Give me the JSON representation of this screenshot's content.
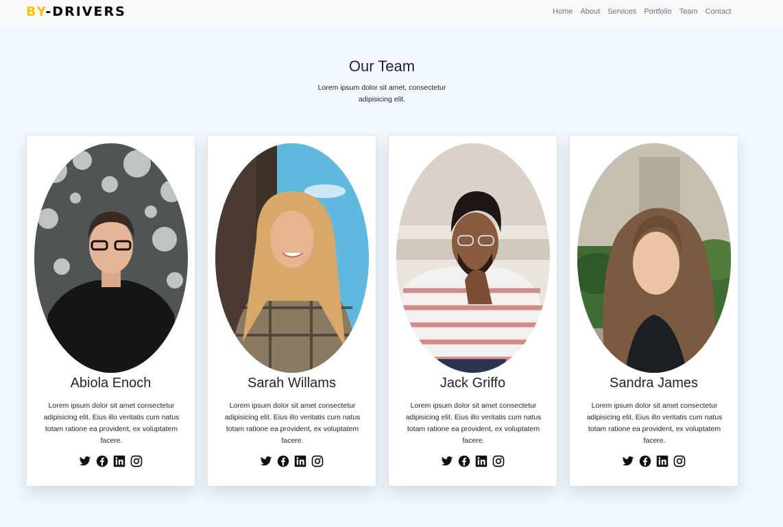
{
  "brand": {
    "prefix": "BY",
    "suffix": "-DRIVERS",
    "accent_color": "#ffc107"
  },
  "nav": [
    "Home",
    "About",
    "Services",
    "Portfolio",
    "Team",
    "Contact"
  ],
  "team": {
    "title": "Our Team",
    "subtitle": "Lorem ipsum dolor sit amet, consectetur adipisicing elit.",
    "members": [
      {
        "name": "Abiola Enoch",
        "bio": "Lorem ipsum dolor sit amet consectetur adipisicing elit. Eius illo veritatis cum natus totam ratione ea provident, ex voluptatem facere."
      },
      {
        "name": "Sarah Willams",
        "bio": "Lorem ipsum dolor sit amet consectetur adipisicing elit. Eius illo veritatis cum natus totam ratione ea provident, ex voluptatem facere."
      },
      {
        "name": "Jack Griffo",
        "bio": "Lorem ipsum dolor sit amet consectetur adipisicing elit. Eius illo veritatis cum natus totam ratione ea provident, ex voluptatem facere."
      },
      {
        "name": "Sandra James",
        "bio": "Lorem ipsum dolor sit amet consectetur adipisicing elit. Eius illo veritatis cum natus totam ratione ea provident, ex voluptatem facere."
      }
    ],
    "social_icons": [
      "twitter-icon",
      "facebook-icon",
      "linkedin-icon",
      "instagram-icon"
    ]
  }
}
